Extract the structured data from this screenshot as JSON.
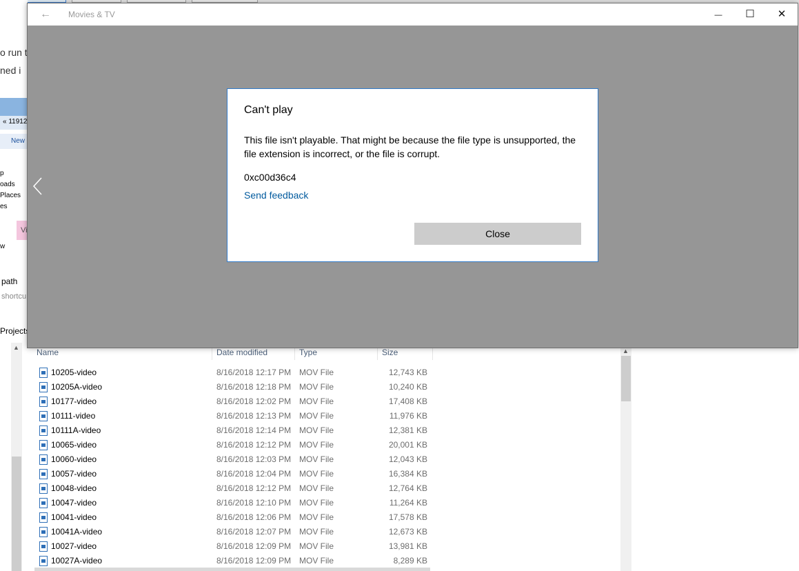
{
  "movies_window": {
    "title": "Movies & TV",
    "back_glyph": "←",
    "minimize_glyph": "—",
    "maximize_glyph": "☐",
    "close_glyph": "✕"
  },
  "dialog": {
    "title": "Can't play",
    "message": "This file isn't playable. That might be because the file type is unsupported, the file extension is incorrect, or the file is corrupt.",
    "error_code": "0xc00d36c4",
    "feedback_link": "Send feedback",
    "close_label": "Close"
  },
  "background_fragments": {
    "f1": "o run t",
    "f2": "ned i",
    "f3": "« 11912",
    "f4": "New",
    "f5": "p",
    "f6": "oads",
    "f7": "Places",
    "f8": "es",
    "f9": "Vi",
    "f10": "w",
    "f11": "path",
    "f12": "shortcu",
    "f13": "Projects"
  },
  "file_list": {
    "columns": [
      "Name",
      "Date modified",
      "Type",
      "Size"
    ],
    "rows": [
      {
        "name": "10205-video",
        "date": "8/16/2018 12:17 PM",
        "type": "MOV File",
        "size": "12,743 KB"
      },
      {
        "name": "10205A-video",
        "date": "8/16/2018 12:18 PM",
        "type": "MOV File",
        "size": "10,240 KB"
      },
      {
        "name": "10177-video",
        "date": "8/16/2018 12:02 PM",
        "type": "MOV File",
        "size": "17,408 KB"
      },
      {
        "name": "10111-video",
        "date": "8/16/2018 12:13 PM",
        "type": "MOV File",
        "size": "11,976 KB"
      },
      {
        "name": "10111A-video",
        "date": "8/16/2018 12:14 PM",
        "type": "MOV File",
        "size": "12,381 KB"
      },
      {
        "name": "10065-video",
        "date": "8/16/2018 12:12 PM",
        "type": "MOV File",
        "size": "20,001 KB"
      },
      {
        "name": "10060-video",
        "date": "8/16/2018 12:03 PM",
        "type": "MOV File",
        "size": "12,043 KB"
      },
      {
        "name": "10057-video",
        "date": "8/16/2018 12:04 PM",
        "type": "MOV File",
        "size": "16,384 KB"
      },
      {
        "name": "10048-video",
        "date": "8/16/2018 12:12 PM",
        "type": "MOV File",
        "size": "12,764 KB"
      },
      {
        "name": "10047-video",
        "date": "8/16/2018 12:10 PM",
        "type": "MOV File",
        "size": "11,264 KB"
      },
      {
        "name": "10041-video",
        "date": "8/16/2018 12:06 PM",
        "type": "MOV File",
        "size": "17,578 KB"
      },
      {
        "name": "10041A-video",
        "date": "8/16/2018 12:07 PM",
        "type": "MOV File",
        "size": "12,673 KB"
      },
      {
        "name": "10027-video",
        "date": "8/16/2018 12:09 PM",
        "type": "MOV File",
        "size": "13,981 KB"
      },
      {
        "name": "10027A-video",
        "date": "8/16/2018 12:09 PM",
        "type": "MOV File",
        "size": "8,289 KB"
      }
    ]
  }
}
